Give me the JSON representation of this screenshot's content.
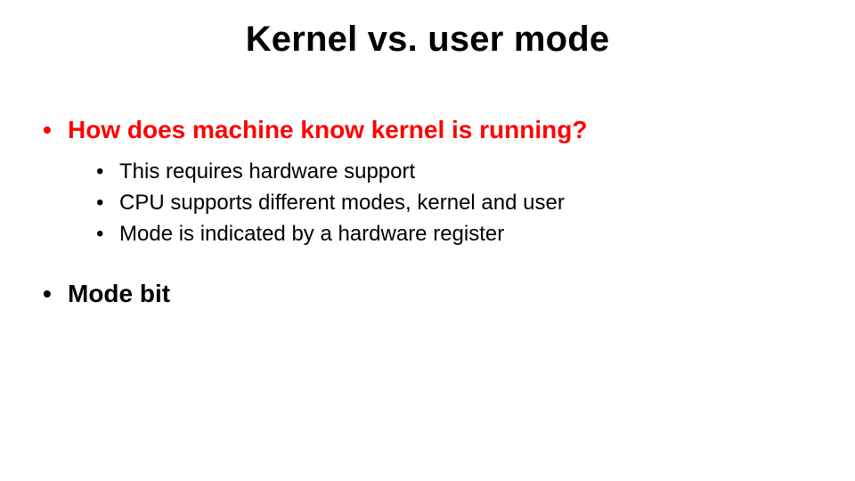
{
  "title": "Kernel vs. user mode",
  "items": [
    {
      "text": "How does machine know kernel is running?",
      "color": "red",
      "sub": [
        "This requires hardware support",
        "CPU supports different modes, kernel and user",
        "Mode is indicated by a hardware register"
      ]
    },
    {
      "text": "Mode bit",
      "color": "black",
      "sub": []
    }
  ]
}
